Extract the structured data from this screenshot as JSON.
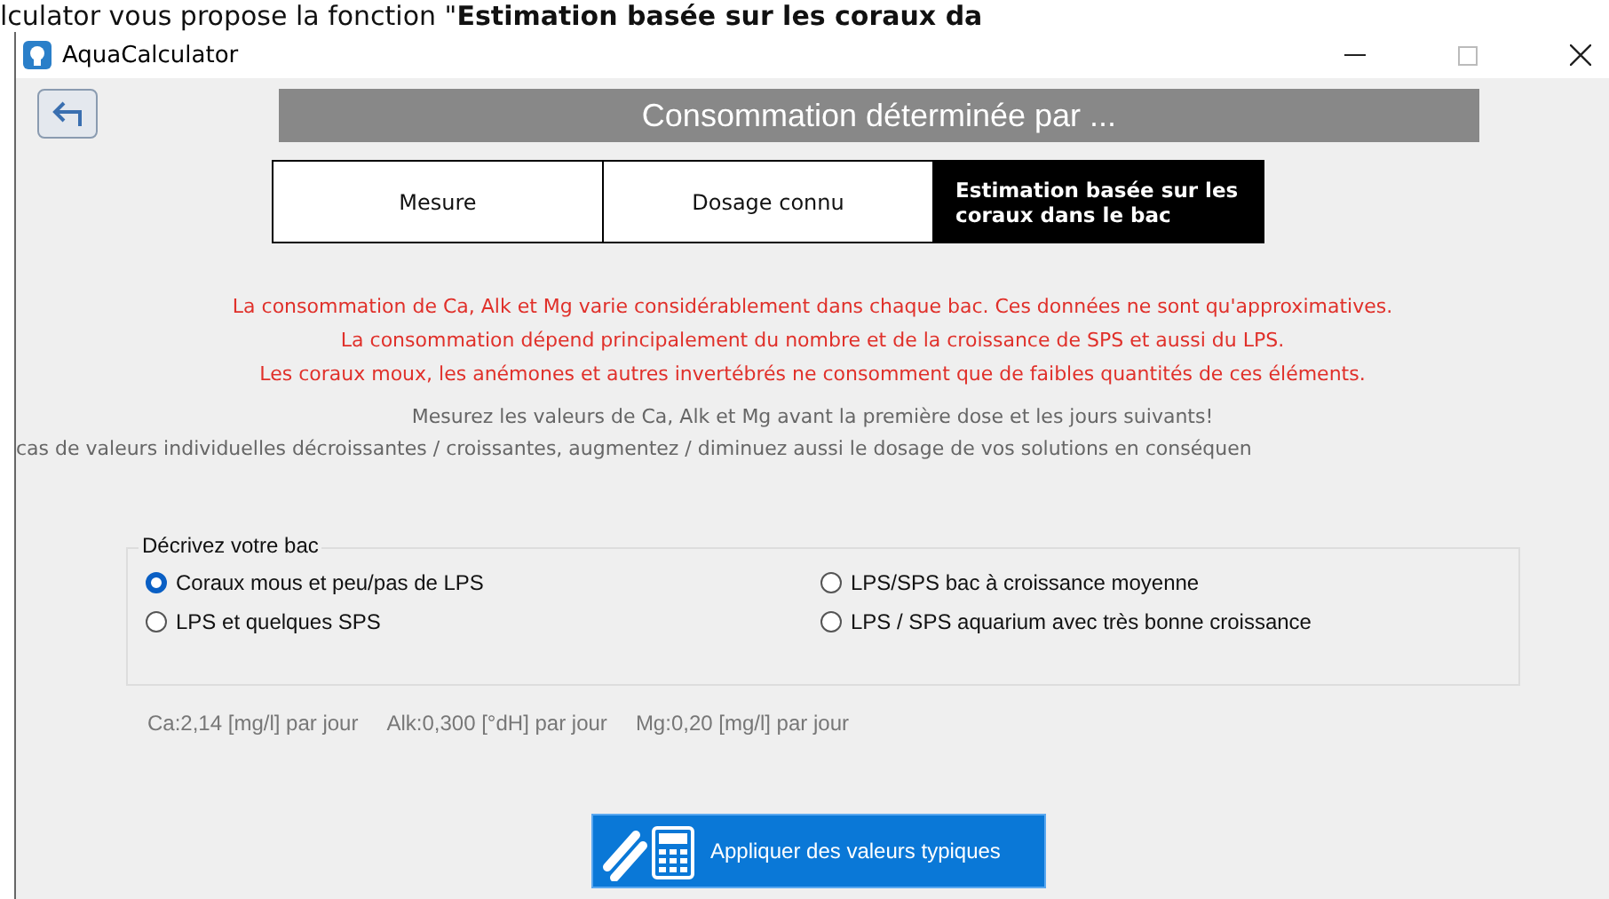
{
  "doc_text": "lculator vous propose la fonction \"**Estimation basée sur les coraux da**",
  "window": {
    "title": "AquaCalculator"
  },
  "header": "Consommation déterminée par ...",
  "tabs": [
    {
      "label": "Mesure",
      "selected": false
    },
    {
      "label": "Dosage connu",
      "selected": false
    },
    {
      "label": "Estimation basée sur les coraux dans le bac",
      "selected": true
    }
  ],
  "warnings": [
    "La consommation de Ca, Alk et Mg varie considérablement dans chaque bac. Ces données ne sont qu'approximatives.",
    "La consommation dépend principalement du nombre et de la croissance de SPS et aussi du LPS.",
    "Les coraux moux, les anémones et autres invertébrés ne consomment que de faibles quantités de ces éléments."
  ],
  "hints": [
    "Mesurez les valeurs de Ca, Alk et Mg avant la première dose et les jours suivants!",
    "cas de valeurs individuelles décroissantes / croissantes, augmentez / diminuez aussi le dosage de vos solutions en conséquen"
  ],
  "group": {
    "title": "Décrivez votre bac",
    "options": [
      {
        "label": "Coraux mous et peu/pas de LPS",
        "selected": true
      },
      {
        "label": "LPS/SPS bac à croissance moyenne",
        "selected": false
      },
      {
        "label": "LPS et quelques SPS",
        "selected": false
      },
      {
        "label": "LPS / SPS aquarium avec très bonne croissance",
        "selected": false
      }
    ]
  },
  "values": [
    "Ca:2,14 [mg/l] par jour",
    "Alk:0,300 [°dH] par jour",
    "Mg:0,20 [mg/l] par jour"
  ],
  "apply_button": "Appliquer des valeurs typiques"
}
